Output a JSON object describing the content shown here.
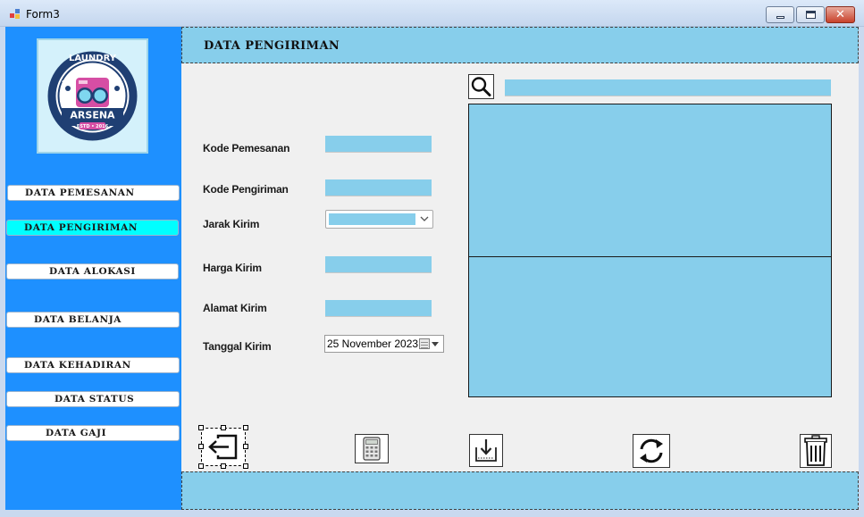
{
  "window": {
    "title": "Form3"
  },
  "sidebar": {
    "logo": {
      "top_text": "LAUNDRY",
      "brand": "ARSENA",
      "est": "ESTD • 2016"
    },
    "items": [
      {
        "label": "DATA PEMESANAN",
        "active": false
      },
      {
        "label": "DATA PENGIRIMAN",
        "active": true
      },
      {
        "label": "DATA ALOKASI",
        "active": false
      },
      {
        "label": "DATA BELANJA",
        "active": false
      },
      {
        "label": "DATA KEHADIRAN",
        "active": false
      },
      {
        "label": "DATA STATUS",
        "active": false
      },
      {
        "label": "DATA GAJI",
        "active": false
      }
    ]
  },
  "header": {
    "title": "DATA PENGIRIMAN"
  },
  "form": {
    "kode_pemesanan": {
      "label": "Kode Pemesanan",
      "value": ""
    },
    "kode_pengiriman": {
      "label": "Kode Pengiriman",
      "value": ""
    },
    "jarak_kirim": {
      "label": "Jarak Kirim",
      "value": ""
    },
    "harga_kirim": {
      "label": "Harga Kirim",
      "value": ""
    },
    "alamat_kirim": {
      "label": "Alamat Kirim",
      "value": ""
    },
    "tanggal_kirim": {
      "label": "Tanggal Kirim",
      "value": "25 November 2023"
    }
  },
  "search": {
    "value": ""
  },
  "actions": [
    "exit-icon",
    "calculator-icon",
    "save-icon",
    "refresh-icon",
    "trash-icon"
  ],
  "colors": {
    "sidebar": "#1e90ff",
    "panel": "#87ceeb",
    "active_nav": "#00ffff"
  }
}
